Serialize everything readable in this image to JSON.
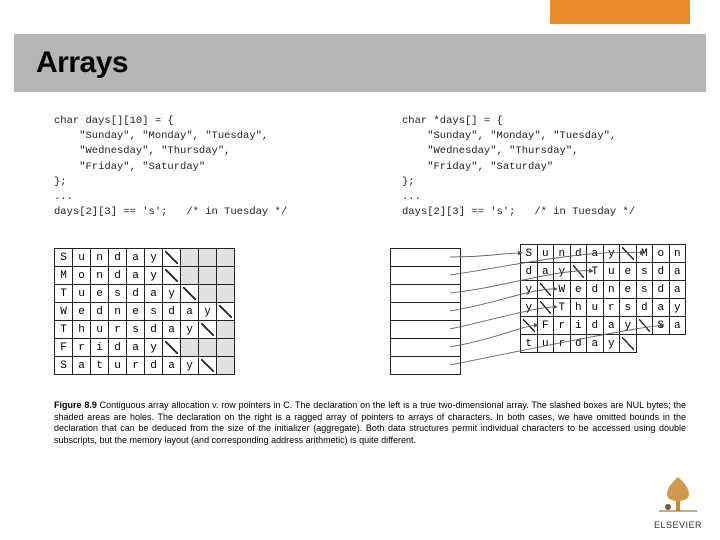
{
  "slide": {
    "title": "Arrays",
    "publisher": "ELSEVIER"
  },
  "code": {
    "left": "char days[][10] = {\n    \"Sunday\", \"Monday\", \"Tuesday\",\n    \"Wednesday\", \"Thursday\",\n    \"Friday\", \"Saturday\"\n};\n...\ndays[2][3] == 's';   /* in Tuesday */",
    "right": "char *days[] = {\n    \"Sunday\", \"Monday\", \"Tuesday\",\n    \"Wednesday\", \"Thursday\",\n    \"Friday\", \"Saturday\"\n};\n...\ndays[2][3] == 's';   /* in Tuesday */"
  },
  "grid": {
    "cols": 10,
    "rows": [
      [
        "S",
        "u",
        "n",
        "d",
        "a",
        "y",
        "/",
        "",
        "",
        ""
      ],
      [
        "M",
        "o",
        "n",
        "d",
        "a",
        "y",
        "/",
        "",
        "",
        ""
      ],
      [
        "T",
        "u",
        "e",
        "s",
        "d",
        "a",
        "y",
        "/",
        "",
        ""
      ],
      [
        "W",
        "e",
        "d",
        "n",
        "e",
        "s",
        "d",
        "a",
        "y",
        "/"
      ],
      [
        "T",
        "h",
        "u",
        "r",
        "s",
        "d",
        "a",
        "y",
        "/",
        ""
      ],
      [
        "F",
        "r",
        "i",
        "d",
        "a",
        "y",
        "/",
        "",
        "",
        ""
      ],
      [
        "S",
        "a",
        "t",
        "u",
        "r",
        "d",
        "a",
        "y",
        "/",
        ""
      ]
    ]
  },
  "ragged": {
    "pointer_rows": 7,
    "strip_cols": 10,
    "strip": [
      [
        "S",
        "u",
        "n",
        "d",
        "a",
        "y",
        "/",
        "M",
        "o",
        "n"
      ],
      [
        "d",
        "a",
        "y",
        "/",
        "T",
        "u",
        "e",
        "s",
        "d",
        "a"
      ],
      [
        "y",
        "/",
        "W",
        "e",
        "d",
        "n",
        "e",
        "s",
        "d",
        "a"
      ],
      [
        "y",
        "/",
        "T",
        "h",
        "u",
        "r",
        "s",
        "d",
        "a",
        "y"
      ],
      [
        "/",
        "F",
        "r",
        "i",
        "d",
        "a",
        "y",
        "/",
        "S",
        "a"
      ],
      [
        "t",
        "u",
        "r",
        "d",
        "a",
        "y",
        "/",
        "",
        "",
        ""
      ]
    ]
  },
  "caption": {
    "label": "Figure 8.9",
    "text": "Contiguous array allocation v. row pointers in C. The declaration on the left is a true two-dimensional array. The slashed boxes are NUL bytes; the shaded areas are holes. The declaration on the right is a ragged array of pointers to arrays of characters. In both cases, we have omitted bounds in the declaration that can be deduced from the size of the initializer (aggregate). Both data structures permit individual characters to be accessed using double subscripts, but the memory layout (and corresponding address arithmetic) is quite different."
  }
}
